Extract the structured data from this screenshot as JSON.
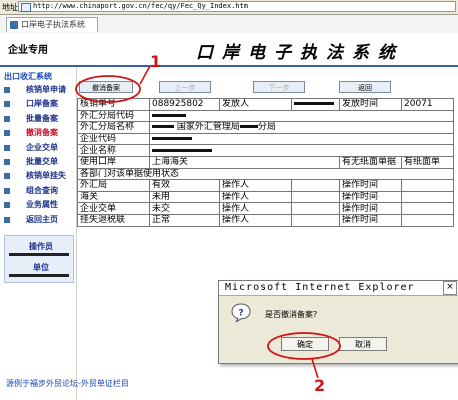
{
  "browser": {
    "address_label": "地址",
    "url": "http://www.chinaport.gov.cn/fec/qy/Fec_Qy_Index.htm",
    "tab_title": "口岸电子执法系统"
  },
  "header": {
    "dept": "企业专用",
    "system_title": "口岸电子执法系统"
  },
  "sidebar": {
    "section_title": "出口收汇系统",
    "items": [
      {
        "label": "核销单申请"
      },
      {
        "label": "口岸备案"
      },
      {
        "label": "批量备案"
      },
      {
        "label": "撤消备案"
      },
      {
        "label": "企业交单"
      },
      {
        "label": "批量交单"
      },
      {
        "label": "核销单挂失"
      },
      {
        "label": "组合查询"
      },
      {
        "label": "业务属性"
      },
      {
        "label": "返回主页"
      }
    ],
    "operator_label": "操作员",
    "unit_label": "单位"
  },
  "toolbar": {
    "cancel_record_label": "撤消备案",
    "prev_label": "上一步",
    "next_label": "下一步",
    "back_label": "返回"
  },
  "info_table": {
    "row1": {
      "k1": "核销单号",
      "v1": "088925802",
      "k2": "发放人",
      "k3": "发放时间",
      "v3": "20071"
    },
    "row2": {
      "k1": "外汇分局代码"
    },
    "row3": {
      "k1": "外汇分局名称",
      "v1a": "国家外汇管理局",
      "v1b": "分局"
    },
    "row4": {
      "k1": "企业代码"
    },
    "row5": {
      "k1": "企业名称"
    },
    "row6": {
      "k1": "使用口岸",
      "v1": "上海海关",
      "k2": "有无纸面单据",
      "v2": "有纸面单"
    },
    "section": "各部门对该单据使用状态",
    "status_rows": [
      {
        "dept": "外汇局",
        "status": "有效",
        "op": "操作人",
        "time": "操作时间"
      },
      {
        "dept": "海关",
        "status": "未用",
        "op": "操作人",
        "time": "操作时间"
      },
      {
        "dept": "企业交单",
        "status": "未交",
        "op": "操作人",
        "time": "操作时间"
      },
      {
        "dept": "挂失退税联",
        "status": "正常",
        "op": "操作人",
        "time": "操作时间"
      }
    ]
  },
  "dialog": {
    "title": "Microsoft Internet Explorer",
    "message": "是否撤消备案?",
    "ok_label": "确定",
    "cancel_label": "取消",
    "close_glyph": "×"
  },
  "annotations": {
    "n1": "1",
    "n2": "2"
  },
  "footer": {
    "text": "源例于福步外贸论坛-外贸单证栏目"
  }
}
